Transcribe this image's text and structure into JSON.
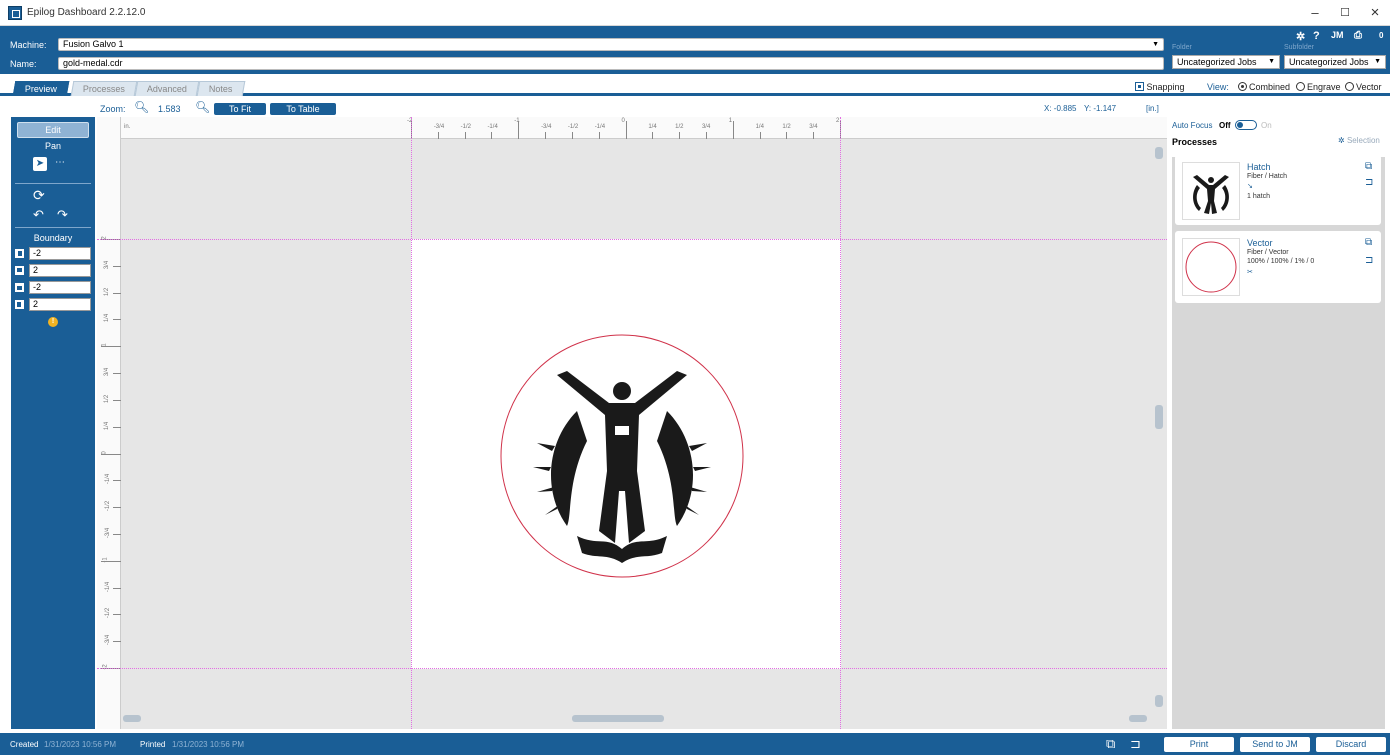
{
  "window": {
    "title": "Epilog Dashboard 2.2.12.0",
    "minimize": "–",
    "maximize": "☐",
    "close": "×"
  },
  "header": {
    "machine_label": "Machine:",
    "machine_value": "Fusion Galvo 1",
    "name_label": "Name:",
    "name_value": "gold-medal.cdr",
    "folder_label": "Folder",
    "folder_value": "Uncategorized Jobs",
    "subfolder_label": "Subfolder",
    "subfolder_value": "Uncategorized Jobs",
    "user_initials": "JM",
    "queue_count": "0"
  },
  "tabs": [
    {
      "label": "Preview"
    },
    {
      "label": "Processes"
    },
    {
      "label": "Advanced"
    },
    {
      "label": "Notes"
    }
  ],
  "view": {
    "snapping_label": "Snapping",
    "view_label": "View:",
    "combined": "Combined",
    "engrave": "Engrave",
    "vector": "Vector",
    "selected": "Combined"
  },
  "zoom": {
    "label": "Zoom:",
    "value": "1.583",
    "to_fit": "To Fit",
    "to_table": "To Table"
  },
  "coords": {
    "x_label": "X:",
    "x_value": "-0.885",
    "y_label": "Y:",
    "y_value": "-1.147",
    "units": "[in.]"
  },
  "left_panel": {
    "edit": "Edit",
    "pan": "Pan",
    "boundary_label": "Boundary",
    "boundary": [
      "-2",
      "2",
      "-2",
      "2"
    ]
  },
  "ruler": {
    "corner": "in.",
    "top_labels": [
      "-2",
      "-3/4",
      "-1/2",
      "-1/4",
      "-1",
      "-3/4",
      "-1/2",
      "-1/4",
      "0",
      "1/4",
      "1/2",
      "3/4",
      "1",
      "1/4",
      "1/2",
      "3/4",
      "2"
    ],
    "left_labels": [
      "2",
      "3/4",
      "1/2",
      "1/4",
      "1",
      "3/4",
      "1/2",
      "1/4",
      "0",
      "-1/4",
      "-1/2",
      "-3/4",
      "-1",
      "-1/4",
      "-1/2",
      "-3/4",
      "-2"
    ]
  },
  "right_panel": {
    "auto_focus_label": "Auto Focus",
    "af_off": "Off",
    "af_on": "On",
    "processes_label": "Processes",
    "selection_label": "Selection",
    "processes": [
      {
        "name": "Hatch",
        "type": "Fiber / Hatch",
        "detail": "1 hatch"
      },
      {
        "name": "Vector",
        "type": "Fiber / Vector",
        "detail": "100% / 100% / 1% / 0"
      }
    ]
  },
  "status": {
    "created_label": "Created",
    "created_value": "1/31/2023 10:56 PM",
    "printed_label": "Printed",
    "printed_value": "1/31/2023 10:56 PM",
    "print": "Print",
    "send_to": "Send to JM",
    "discard": "Discard"
  },
  "colors": {
    "accent": "#1a5e96",
    "guide": "#e26ee2",
    "vector_circle": "#d0324a"
  }
}
